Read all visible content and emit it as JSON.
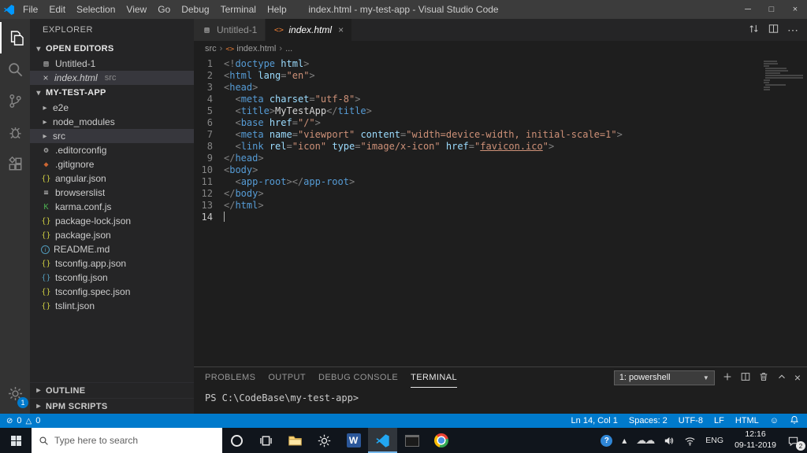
{
  "icons": {
    "minimize": "─",
    "maximize": "□",
    "close": "×",
    "chevron_down": "▾",
    "chevron_right": "▸",
    "dropdown_arrow": "▼",
    "breadcrumb_sep": "›",
    "error": "⊘",
    "warning": "△",
    "smiley": "☺",
    "cloud": "☁☁",
    "more": "⋯",
    "word_letter": "W",
    "help_mark": "?",
    "tray_chevron": "▴"
  },
  "title_bar": {
    "title": "index.html - my-test-app - Visual Studio Code",
    "menus": [
      "File",
      "Edit",
      "Selection",
      "View",
      "Go",
      "Debug",
      "Terminal",
      "Help"
    ]
  },
  "activity_bar": {
    "items": [
      {
        "id": "explorer",
        "active": true
      },
      {
        "id": "search",
        "active": false
      },
      {
        "id": "source-control",
        "active": false
      },
      {
        "id": "debug",
        "active": false
      },
      {
        "id": "extensions",
        "active": false
      }
    ],
    "bottom": {
      "id": "settings",
      "badge": "1"
    }
  },
  "sidebar": {
    "header": "EXPLORER",
    "open_editors": {
      "label": "OPEN EDITORS",
      "items": [
        {
          "name": "Untitled-1",
          "icon": "file",
          "icon_color": "#c5c5c5",
          "active": false,
          "detail": "",
          "italic": false
        },
        {
          "name": "index.html",
          "icon": "html",
          "icon_color": "#e37933",
          "active": true,
          "detail": "src",
          "italic": true
        }
      ]
    },
    "project": {
      "label": "MY-TEST-APP",
      "entries": [
        {
          "name": "e2e",
          "type": "folder"
        },
        {
          "name": "node_modules",
          "type": "folder"
        },
        {
          "name": "src",
          "type": "folder",
          "selected": true
        },
        {
          "name": ".editorconfig",
          "type": "file",
          "icon": "gear",
          "icon_color": "#c5c5c5"
        },
        {
          "name": ".gitignore",
          "type": "file",
          "icon": "diamond",
          "icon_color": "#cc6633"
        },
        {
          "name": "angular.json",
          "type": "file",
          "icon": "braces",
          "icon_color": "#cbcb41"
        },
        {
          "name": "browserslist",
          "type": "file",
          "icon": "list",
          "icon_color": "#c5c5c5"
        },
        {
          "name": "karma.conf.js",
          "type": "file",
          "icon": "karma",
          "icon_color": "#4caf50"
        },
        {
          "name": "package-lock.json",
          "type": "file",
          "icon": "braces",
          "icon_color": "#cbcb41"
        },
        {
          "name": "package.json",
          "type": "file",
          "icon": "braces",
          "icon_color": "#cbcb41"
        },
        {
          "name": "README.md",
          "type": "file",
          "icon": "info",
          "icon_color": "#519aba"
        },
        {
          "name": "tsconfig.app.json",
          "type": "file",
          "icon": "braces",
          "icon_color": "#cbcb41"
        },
        {
          "name": "tsconfig.json",
          "type": "file",
          "icon": "braces",
          "icon_color": "#519aba"
        },
        {
          "name": "tsconfig.spec.json",
          "type": "file",
          "icon": "braces",
          "icon_color": "#cbcb41"
        },
        {
          "name": "tslint.json",
          "type": "file",
          "icon": "braces",
          "icon_color": "#cbcb41"
        }
      ]
    },
    "bottom_sections": [
      "OUTLINE",
      "NPM SCRIPTS"
    ]
  },
  "editor": {
    "tabs": [
      {
        "label": "Untitled-1",
        "icon": "file",
        "icon_color": "#c5c5c5",
        "active": false,
        "italic": false,
        "closable": false
      },
      {
        "label": "index.html",
        "icon": "html",
        "icon_color": "#e37933",
        "active": true,
        "italic": true,
        "closable": true
      }
    ],
    "breadcrumb": [
      {
        "label": "src"
      },
      {
        "label": "index.html",
        "icon": "html"
      },
      {
        "label": "..."
      }
    ],
    "code": {
      "lines": [
        {
          "no": 1,
          "tokens": [
            [
              "<!",
              "p"
            ],
            [
              "doctype",
              "t"
            ],
            [
              " ",
              "x"
            ],
            [
              "html",
              "a"
            ],
            [
              ">",
              "p"
            ]
          ]
        },
        {
          "no": 2,
          "tokens": [
            [
              "<",
              "p"
            ],
            [
              "html",
              "t"
            ],
            [
              " ",
              "x"
            ],
            [
              "lang",
              "a"
            ],
            [
              "=",
              "p"
            ],
            [
              "\"en\"",
              "v"
            ],
            [
              ">",
              "p"
            ]
          ]
        },
        {
          "no": 3,
          "tokens": [
            [
              "<",
              "p"
            ],
            [
              "head",
              "t"
            ],
            [
              ">",
              "p"
            ]
          ]
        },
        {
          "no": 4,
          "tokens": [
            [
              "  ",
              "x"
            ],
            [
              "<",
              "p"
            ],
            [
              "meta",
              "t"
            ],
            [
              " ",
              "x"
            ],
            [
              "charset",
              "a"
            ],
            [
              "=",
              "p"
            ],
            [
              "\"utf-8\"",
              "v"
            ],
            [
              ">",
              "p"
            ]
          ]
        },
        {
          "no": 5,
          "tokens": [
            [
              "  ",
              "x"
            ],
            [
              "<",
              "p"
            ],
            [
              "title",
              "t"
            ],
            [
              ">",
              "p"
            ],
            [
              "MyTestApp",
              "x"
            ],
            [
              "</",
              "p"
            ],
            [
              "title",
              "t"
            ],
            [
              ">",
              "p"
            ]
          ]
        },
        {
          "no": 6,
          "tokens": [
            [
              "  ",
              "x"
            ],
            [
              "<",
              "p"
            ],
            [
              "base",
              "t"
            ],
            [
              " ",
              "x"
            ],
            [
              "href",
              "a"
            ],
            [
              "=",
              "p"
            ],
            [
              "\"/\"",
              "v"
            ],
            [
              ">",
              "p"
            ]
          ]
        },
        {
          "no": 7,
          "tokens": [
            [
              "  ",
              "x"
            ],
            [
              "<",
              "p"
            ],
            [
              "meta",
              "t"
            ],
            [
              " ",
              "x"
            ],
            [
              "name",
              "a"
            ],
            [
              "=",
              "p"
            ],
            [
              "\"viewport\"",
              "v"
            ],
            [
              " ",
              "x"
            ],
            [
              "content",
              "a"
            ],
            [
              "=",
              "p"
            ],
            [
              "\"width=device-width, initial-scale=1\"",
              "v"
            ],
            [
              ">",
              "p"
            ]
          ]
        },
        {
          "no": 8,
          "tokens": [
            [
              "  ",
              "x"
            ],
            [
              "<",
              "p"
            ],
            [
              "link",
              "t"
            ],
            [
              " ",
              "x"
            ],
            [
              "rel",
              "a"
            ],
            [
              "=",
              "p"
            ],
            [
              "\"icon\"",
              "v"
            ],
            [
              " ",
              "x"
            ],
            [
              "type",
              "a"
            ],
            [
              "=",
              "p"
            ],
            [
              "\"image/x-icon\"",
              "v"
            ],
            [
              " ",
              "x"
            ],
            [
              "href",
              "a"
            ],
            [
              "=",
              "p"
            ],
            [
              "\"",
              "v"
            ],
            [
              "favicon.ico",
              "l"
            ],
            [
              "\"",
              "v"
            ],
            [
              ">",
              "p"
            ]
          ]
        },
        {
          "no": 9,
          "tokens": [
            [
              "</",
              "p"
            ],
            [
              "head",
              "t"
            ],
            [
              ">",
              "p"
            ]
          ]
        },
        {
          "no": 10,
          "tokens": [
            [
              "<",
              "p"
            ],
            [
              "body",
              "t"
            ],
            [
              ">",
              "p"
            ]
          ]
        },
        {
          "no": 11,
          "tokens": [
            [
              "  ",
              "x"
            ],
            [
              "<",
              "p"
            ],
            [
              "app-root",
              "t"
            ],
            [
              "></",
              "p"
            ],
            [
              "app-root",
              "t"
            ],
            [
              ">",
              "p"
            ]
          ]
        },
        {
          "no": 12,
          "tokens": [
            [
              "</",
              "p"
            ],
            [
              "body",
              "t"
            ],
            [
              ">",
              "p"
            ]
          ]
        },
        {
          "no": 13,
          "tokens": [
            [
              "</",
              "p"
            ],
            [
              "html",
              "t"
            ],
            [
              ">",
              "p"
            ]
          ]
        },
        {
          "no": 14,
          "tokens": [],
          "active": true
        }
      ]
    }
  },
  "panel": {
    "tabs": [
      {
        "label": "PROBLEMS",
        "active": false
      },
      {
        "label": "OUTPUT",
        "active": false
      },
      {
        "label": "DEBUG CONSOLE",
        "active": false
      },
      {
        "label": "TERMINAL",
        "active": true
      }
    ],
    "shell_selector": "1: powershell",
    "terminal": {
      "prompt": "PS C:\\CodeBase\\my-test-app>"
    }
  },
  "status_bar": {
    "errors": "0",
    "warnings": "0",
    "right_items": [
      "Ln 14, Col 1",
      "Spaces: 2",
      "UTF-8",
      "LF",
      "HTML"
    ]
  },
  "taskbar": {
    "search": {
      "placeholder": "Type here to search"
    },
    "tray": {
      "language": "ENG",
      "time": "12:16",
      "date": "09-11-2019",
      "notification_badge": "2"
    }
  }
}
